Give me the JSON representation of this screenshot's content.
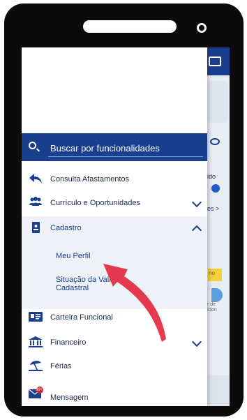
{
  "search": {
    "placeholder": "Buscar por funcionalidades"
  },
  "menu": {
    "consulta": "Consulta Afastamentos",
    "curriculo": "Currículo e Oportunidades",
    "cadastro": "Cadastro",
    "meu_perfil": "Meu Perfil",
    "situacao_line1": "Situação da Vali",
    "situacao_line2": "Cadastral",
    "carteira": "Carteira Funcional",
    "financeiro": "Financeiro",
    "ferias": "Férias",
    "mensagem": "Mensagem",
    "mensagem_badge": "99+"
  },
  "background": {
    "text1": "ido",
    "text2": "es >",
    "yellow": "no",
    "small1": "r de",
    "small2": "ídon"
  },
  "colors": {
    "primary": "#1a3f8f",
    "highlight": "#eef2f8",
    "arrow": "#e53950"
  },
  "icons": [
    "search-icon",
    "back-arrow-icon",
    "people-icon",
    "id-badge-icon",
    "id-card-icon",
    "bank-icon",
    "beach-umbrella-icon",
    "envelope-icon",
    "chevron-down-icon",
    "chevron-up-icon"
  ]
}
